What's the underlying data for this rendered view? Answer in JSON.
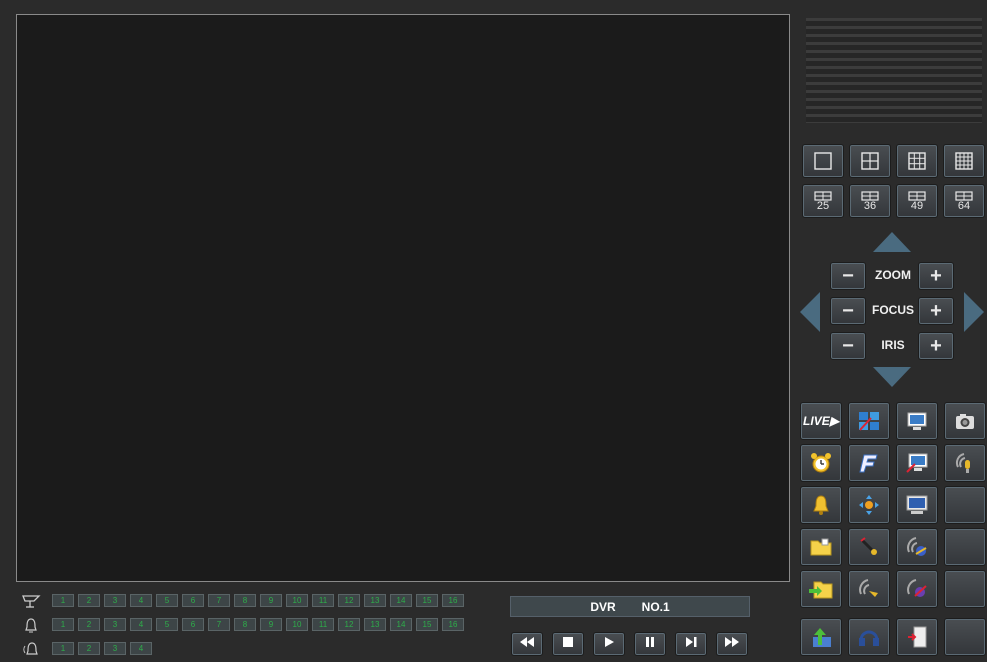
{
  "layout_buttons": [
    {
      "name": "layout-1-button",
      "label": ""
    },
    {
      "name": "layout-4-button",
      "label": ""
    },
    {
      "name": "layout-9-button",
      "label": ""
    },
    {
      "name": "layout-16-button",
      "label": ""
    },
    {
      "name": "layout-25-button",
      "label": "25"
    },
    {
      "name": "layout-36-button",
      "label": "36"
    },
    {
      "name": "layout-49-button",
      "label": "49"
    },
    {
      "name": "layout-64-button",
      "label": "64"
    }
  ],
  "ptz": {
    "zoom_label": "ZOOM",
    "focus_label": "FOCUS",
    "iris_label": "IRIS",
    "minus": "−",
    "plus": "+"
  },
  "function_icons": [
    "live-play-icon",
    "split-windows-icon",
    "monitor-icon",
    "camera-snapshot-icon",
    "alarm-clock-icon",
    "f-logo-icon",
    "monitor-disconnect-icon",
    "microphone-icon",
    "bell-icon",
    "ptz-direction-icon",
    "display-icon",
    "empty-slot",
    "folder-icon",
    "microphone-slash-icon",
    "audio-talk-icon",
    "empty-slot",
    "folder-export-icon",
    "audio-wave-icon",
    "audio-mute-icon",
    "empty-slot",
    "upload-arrow-icon",
    "headphones-icon",
    "door-exit-icon",
    "empty-slot"
  ],
  "live_label": "LIVE",
  "channels": {
    "video": [
      "1",
      "2",
      "3",
      "4",
      "5",
      "6",
      "7",
      "8",
      "9",
      "10",
      "11",
      "12",
      "13",
      "14",
      "15",
      "16"
    ],
    "alarm": [
      "1",
      "2",
      "3",
      "4",
      "5",
      "6",
      "7",
      "8",
      "9",
      "10",
      "11",
      "12",
      "13",
      "14",
      "15",
      "16"
    ],
    "output": [
      "1",
      "2",
      "3",
      "4"
    ]
  },
  "dvr": {
    "name": "DVR",
    "number": "NO.1"
  },
  "playback": [
    "rewind-icon",
    "stop-icon",
    "play-icon",
    "pause-icon",
    "step-forward-icon",
    "fast-forward-icon"
  ],
  "colors": {
    "background": "#2b2b2b",
    "video_area": "#1b1b1b",
    "channel_text": "#2eae4a",
    "button_border": "#5b6a74"
  }
}
